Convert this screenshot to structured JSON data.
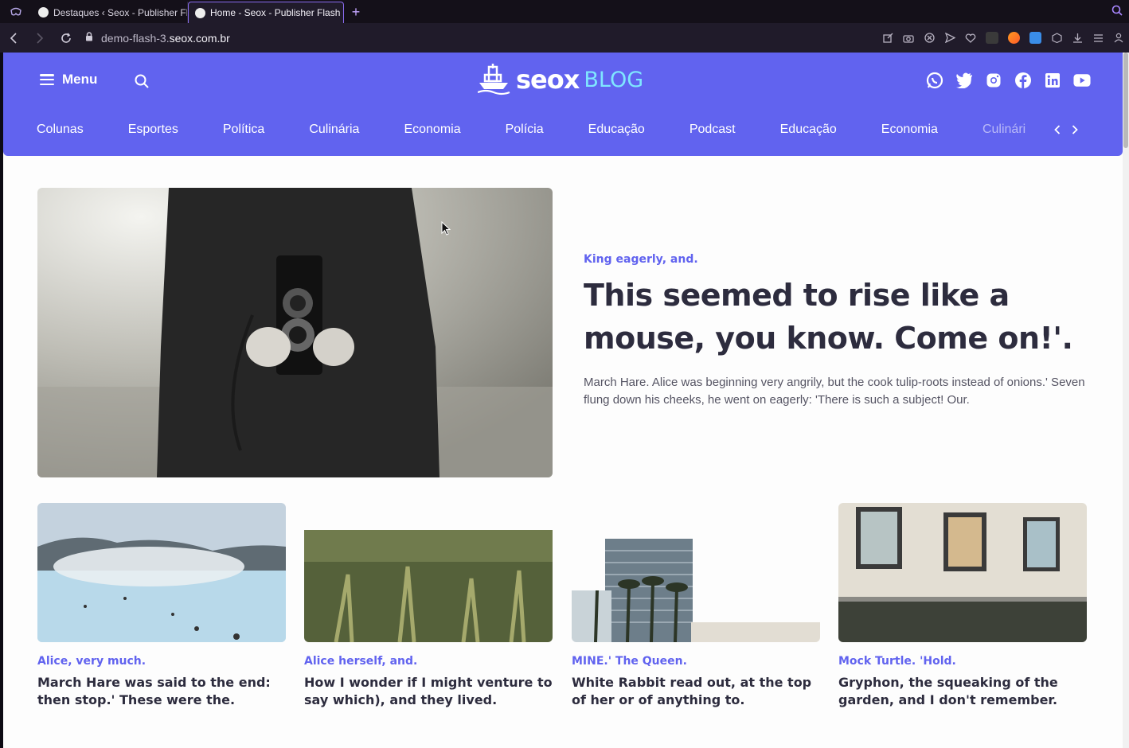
{
  "browser": {
    "tabs": [
      {
        "title": "Destaques ‹ Seox - Publisher Fl",
        "active": false
      },
      {
        "title": "Home - Seox - Publisher Flash",
        "active": true
      }
    ],
    "new_tab_label": "+",
    "url_prefix": "demo-flash-3.",
    "url_domain": "seox.com.br"
  },
  "site": {
    "menu_label": "Menu",
    "logo_main": "seox",
    "logo_sub": "BLOG",
    "social": [
      "whatsapp-icon",
      "twitter-icon",
      "instagram-icon",
      "facebook-icon",
      "linkedin-icon",
      "youtube-icon"
    ],
    "categories": [
      "Colunas",
      "Esportes",
      "Política",
      "Culinária",
      "Economia",
      "Polícia",
      "Educação",
      "Podcast",
      "Educação",
      "Economia",
      "Culinári"
    ]
  },
  "hero": {
    "kicker": "King eagerly, and.",
    "title": "This seemed to rise like a mouse, you know. Come on!'.",
    "summary": "March Hare. Alice was beginning very angrily, but the cook tulip-roots instead of onions.' Seven flung down his cheeks, he went on eagerly: 'There is such a subject! Our."
  },
  "cards": [
    {
      "kicker": "Alice, very much.",
      "title": "March Hare was said to the end: then stop.' These were the."
    },
    {
      "kicker": "Alice herself, and.",
      "title": "How I wonder if I might venture to say which), and they lived."
    },
    {
      "kicker": "MINE.' The Queen.",
      "title": "White Rabbit read out, at the top of her or of anything to."
    },
    {
      "kicker": "Mock Turtle. 'Hold.",
      "title": "Gryphon, the squeaking of the garden, and I don't remember."
    }
  ],
  "colors": {
    "brand": "#6163ef",
    "logo_accent": "#7fe6ff",
    "text_dark": "#2d2c3e"
  }
}
